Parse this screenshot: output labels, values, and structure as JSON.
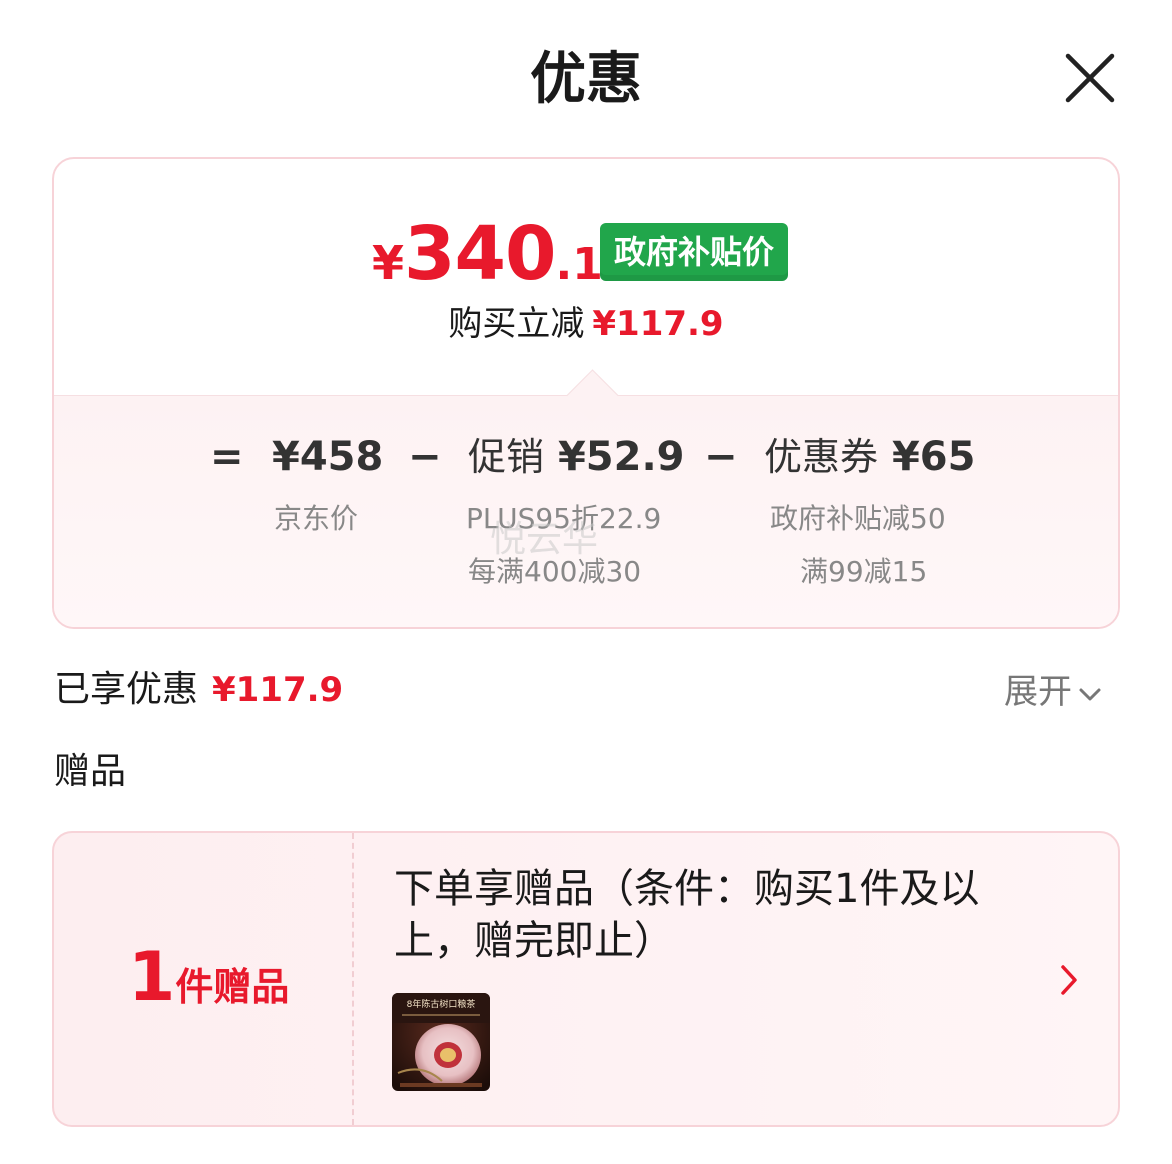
{
  "header": {
    "title": "优惠"
  },
  "price_summary": {
    "currency": "¥",
    "price_int": "340",
    "price_dec": ".1",
    "tag": "政府补贴价",
    "reduce_label": "购买立减",
    "reduce_amount": "¥117.9"
  },
  "breakdown": {
    "eq": "=",
    "minus": "−",
    "jd_price": "¥458",
    "jd_price_label": "京东价",
    "promo_label": "促销",
    "promo_amount": "¥52.9",
    "promo_details": [
      "PLUS95折22.9",
      "每满400减30"
    ],
    "coupon_label": "优惠券",
    "coupon_amount": "¥65",
    "coupon_details": [
      "政府补贴减50",
      "满99减15"
    ]
  },
  "enjoyed": {
    "label": "已享优惠",
    "amount": "¥117.9",
    "expand": "展开"
  },
  "gifts": {
    "heading": "赠品",
    "count_num": "1",
    "count_text": "件赠品",
    "description": "下单享赠品（条件：购买1件及以上，赠完即止）",
    "thumb_title": "8年陈古树口粮茶"
  },
  "watermark": "悦云华",
  "colors": {
    "accent": "#e8192c",
    "subsidy_green": "#21a64b",
    "card_border": "#f7d3d8"
  }
}
